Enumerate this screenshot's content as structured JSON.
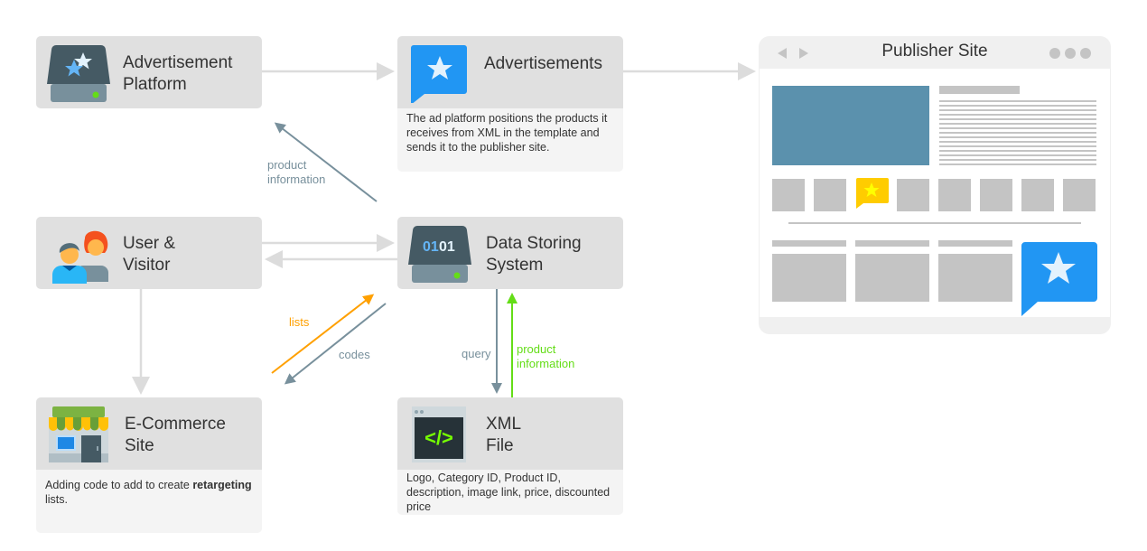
{
  "nodes": {
    "ad_platform": {
      "title": "Advertisement\nPlatform",
      "icon": "server-stars-icon"
    },
    "advertisements": {
      "title": "Advertisements",
      "icon": "star-chat-bubble-icon",
      "description": "The ad platform positions the products it receives from XML in the template and sends it to the publisher site."
    },
    "user_visitor": {
      "title": "User &\nVisitor",
      "icon": "users-icon"
    },
    "data_storing": {
      "title": "Data Storing\nSystem",
      "icon": "server-binary-icon",
      "icon_text_a": "01",
      "icon_text_b": "01"
    },
    "ecommerce": {
      "title": "E-Commerce\nSite",
      "icon": "storefront-icon",
      "description_pre": "Adding code to add to create ",
      "description_bold": "retargeting",
      "description_post": " lists."
    },
    "xml_file": {
      "title": "XML\nFile",
      "icon": "code-window-icon",
      "icon_text": "</>",
      "description": "Logo, Category ID, Product ID, description, image link, price, discounted price"
    }
  },
  "edges": {
    "product_info_up": "product\ninformation",
    "lists": "lists",
    "codes": "codes",
    "query": "query",
    "product_info_green": "product\ninformation"
  },
  "publisher": {
    "title": "Publisher Site"
  },
  "colors": {
    "node_bg": "#e0e0e0",
    "desc_bg": "#f4f4f4",
    "arrow_gray": "#dcdcdc",
    "arrow_slate": "#78909c",
    "arrow_orange": "#ffa000",
    "arrow_green": "#64dd17",
    "accent_blue": "#2196f3",
    "hero_blue": "#5b91ad",
    "ad_yellow": "#ffcc00"
  }
}
